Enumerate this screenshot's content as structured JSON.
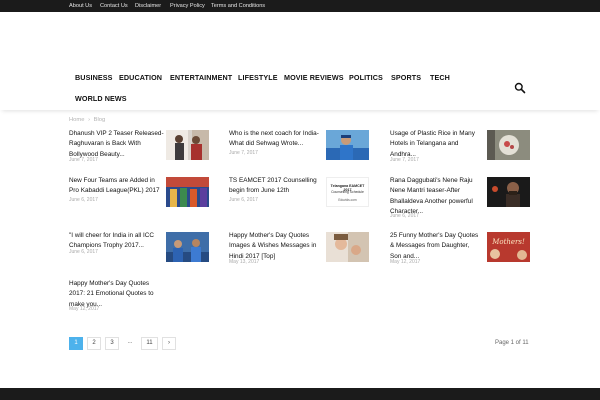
{
  "topbar": {
    "links": [
      "About Us",
      "Contact Us",
      "Disclaimer",
      "Privacy Policy",
      "Terms and Conditions"
    ]
  },
  "nav": {
    "items": [
      "BUSINESS",
      "EDUCATION",
      "ENTERTAINMENT",
      "LIFESTYLE",
      "MOVIE REVIEWS",
      "POLITICS",
      "SPORTS",
      "TECH",
      "WORLD NEWS"
    ],
    "search_icon": "search-icon"
  },
  "breadcrumb": {
    "home": "Home",
    "separator": "›",
    "current": "Blog"
  },
  "posts": [
    {
      "lines": [
        "Dhanush VIP 2 Teaser Released-",
        "Raghuvaran is Back With",
        "Bollywood Beauty..."
      ],
      "date": "June 7, 2017"
    },
    {
      "lines": [
        "Who is the next coach for India-",
        "What did Sehwag Wrote..."
      ],
      "date": "June 7, 2017"
    },
    {
      "lines": [
        "Usage of Plastic Rice in Many",
        "Hotels in Telangana and",
        "Andhra..."
      ],
      "date": "June 7, 2017"
    },
    {
      "lines": [
        "New Four Teams are Added in",
        "Pro Kabaddi League(PKL) 2017"
      ],
      "date": "June 6, 2017"
    },
    {
      "lines": [
        "TS EAMCET 2017 Counselling",
        "begin from June 12th"
      ],
      "date": "June 6, 2017"
    },
    {
      "lines": [
        "Rana Daggubati's Nene Raju",
        "Nene Mantri teaser-After",
        "Bhallaldeva Another powerful",
        "Character..."
      ],
      "date": "June 6, 2017"
    },
    {
      "lines": [
        "\"I will cheer for India in all ICC",
        "Champions Trophy 2017..."
      ],
      "date": "June 6, 2017"
    },
    {
      "lines": [
        "Happy Mother's Day Quotes",
        "Images & Wishes Messages in",
        "Hindi 2017 [Top]"
      ],
      "date": "May 13, 2017"
    },
    {
      "lines": [
        "25 Funny Mother's Day Quotes",
        "& Messages from Daughter,",
        "Son and..."
      ],
      "date": "May 12, 2017"
    },
    {
      "lines": [
        "Happy Mother's Day Quotes",
        "2017: 21 Emotional Quotes to",
        "make you..."
      ],
      "date": "May 12, 2017"
    }
  ],
  "thumbs": {
    "eamcet": {
      "line1": "Telangana EAMCET 2017",
      "line2": "Counselling Schedule",
      "line3": "Eduvids.com"
    },
    "mothers": "Mothers!"
  },
  "pagination": {
    "pages": [
      "1",
      "2",
      "3"
    ],
    "dots": "...",
    "last": "11",
    "next": "›",
    "info": "Page 1 of 11"
  }
}
